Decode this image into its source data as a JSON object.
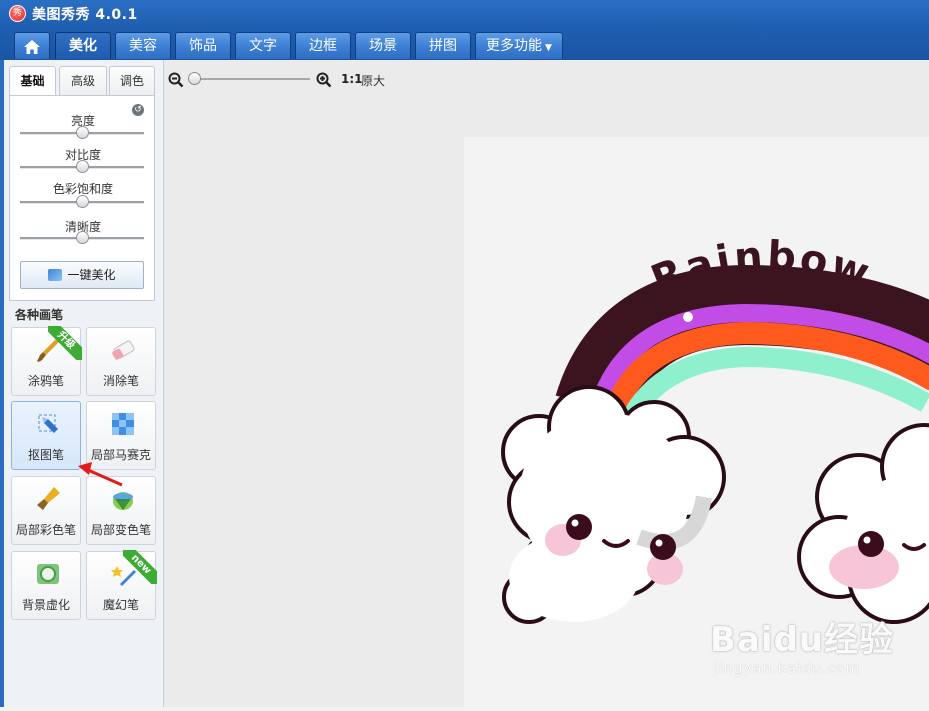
{
  "window": {
    "title": "美图秀秀 4.0.1",
    "logo_text": "秀"
  },
  "tabs": [
    {
      "label": "美化",
      "active": true
    },
    {
      "label": "美容"
    },
    {
      "label": "饰品"
    },
    {
      "label": "文字"
    },
    {
      "label": "边框"
    },
    {
      "label": "场景"
    },
    {
      "label": "拼图"
    },
    {
      "label": "更多功能"
    }
  ],
  "subtabs": [
    "基础",
    "高级",
    "调色"
  ],
  "adjustments": [
    {
      "label": "亮度",
      "value": 0.5
    },
    {
      "label": "对比度",
      "value": 0.5
    },
    {
      "label": "色彩饱和度",
      "value": 0.5
    },
    {
      "label": "清晰度",
      "value": 0.5
    }
  ],
  "one_click_label": "一键美化",
  "brushes": {
    "heading": "各种画笔",
    "items": [
      {
        "label": "涂鸦笔",
        "badge": "升级",
        "icon": "brush-icon"
      },
      {
        "label": "消除笔",
        "icon": "eraser-icon"
      },
      {
        "label": "抠图笔",
        "icon": "cutout-pen-icon",
        "selected": true
      },
      {
        "label": "局部马赛克",
        "icon": "mosaic-icon"
      },
      {
        "label": "局部彩色笔",
        "icon": "color-brush-icon"
      },
      {
        "label": "局部变色笔",
        "icon": "color-change-icon"
      },
      {
        "label": "背景虚化",
        "icon": "blur-icon"
      },
      {
        "label": "魔幻笔",
        "badge": "new",
        "icon": "magic-wand-icon"
      }
    ]
  },
  "zoom": {
    "ratio": "1:1",
    "actual_size_label": "原大",
    "level": 0
  },
  "image": {
    "text": "Rainbow"
  },
  "watermark": {
    "main": "Baidu经验",
    "sub": "jingyan.baidu.com"
  },
  "colors": {
    "accent": "#1f5eb0",
    "tab": "#3b7ed3"
  }
}
